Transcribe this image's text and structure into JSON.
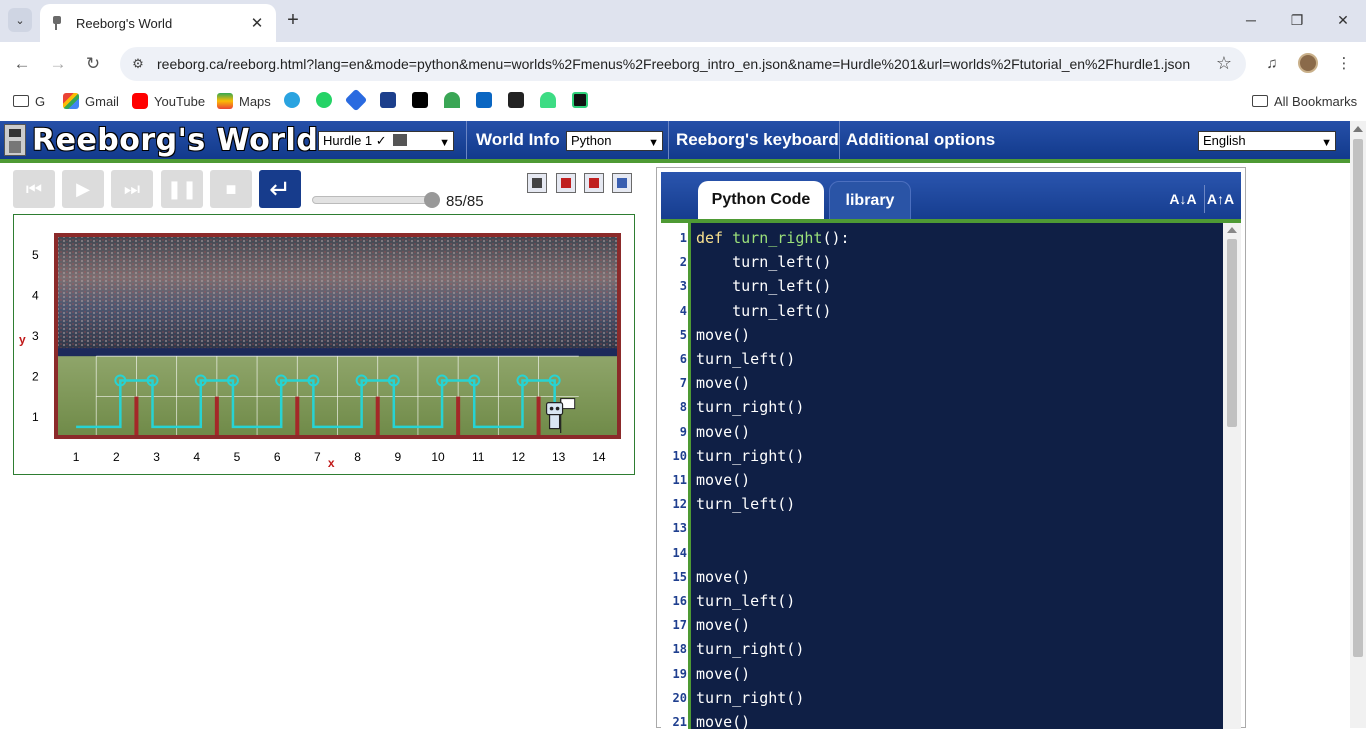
{
  "browser": {
    "tab_title": "Reeborg's World",
    "url": "reeborg.ca/reeborg.html?lang=en&mode=python&menu=worlds%2Fmenus%2Freeborg_intro_en.json&name=Hurdle%201&url=worlds%2Ftutorial_en%2Fhurdle1.json",
    "bookmarks": [
      {
        "label": "G",
        "icon": "folder-icon"
      },
      {
        "label": "Gmail",
        "icon": "gmail-icon"
      },
      {
        "label": "YouTube",
        "icon": "youtube-icon"
      },
      {
        "label": "Maps",
        "icon": "maps-icon"
      }
    ],
    "all_bookmarks_label": "All Bookmarks"
  },
  "app": {
    "title": "Reeborg's World",
    "world_select": "Hurdle 1 ✓",
    "world_info_label": "World Info",
    "language_mode": "Python",
    "keyboard_label": "Reeborg's keyboard",
    "options_label": "Additional options",
    "ui_language": "English",
    "step_count": "85/85",
    "step_fraction": 1.0
  },
  "world": {
    "y_axis_label": "y",
    "x_axis_label": "x",
    "y_ticks": [
      "1",
      "2",
      "3",
      "4",
      "5"
    ],
    "x_ticks": [
      "1",
      "2",
      "3",
      "4",
      "5",
      "6",
      "7",
      "8",
      "9",
      "10",
      "11",
      "12",
      "13",
      "14"
    ],
    "background": "stadium crowd over grass field",
    "robot_position": {
      "x": 13,
      "y": 1
    },
    "goal_flag_position": {
      "x": 13,
      "y": 1
    },
    "hurdle_after_x": [
      2,
      4,
      6,
      8,
      10,
      12
    ],
    "colors": {
      "wall": "#a42828",
      "trace": "#27d3d3",
      "border": "#8b2a2a"
    }
  },
  "editor": {
    "tabs": [
      "Python Code",
      "library"
    ],
    "active_tab": "Python Code",
    "font_decrease_label": "A↓A",
    "font_increase_label": "A↑A",
    "lines": [
      {
        "n": "1",
        "kw": "def",
        "fn": "turn_right",
        "rest": "():"
      },
      {
        "n": "2",
        "text": "    turn_left()"
      },
      {
        "n": "3",
        "text": "    turn_left()"
      },
      {
        "n": "4",
        "text": "    turn_left()"
      },
      {
        "n": "5",
        "text": "move()"
      },
      {
        "n": "6",
        "text": "turn_left()"
      },
      {
        "n": "7",
        "text": "move()"
      },
      {
        "n": "8",
        "text": "turn_right()"
      },
      {
        "n": "9",
        "text": "move()"
      },
      {
        "n": "10",
        "text": "turn_right()"
      },
      {
        "n": "11",
        "text": "move()"
      },
      {
        "n": "12",
        "text": "turn_left()"
      },
      {
        "n": "13",
        "text": ""
      },
      {
        "n": "14",
        "text": ""
      },
      {
        "n": "15",
        "text": "move()"
      },
      {
        "n": "16",
        "text": "turn_left()"
      },
      {
        "n": "17",
        "text": "move()"
      },
      {
        "n": "18",
        "text": "turn_right()"
      },
      {
        "n": "19",
        "text": "move()"
      },
      {
        "n": "20",
        "text": "turn_right()"
      },
      {
        "n": "21",
        "text": "move()"
      }
    ]
  }
}
